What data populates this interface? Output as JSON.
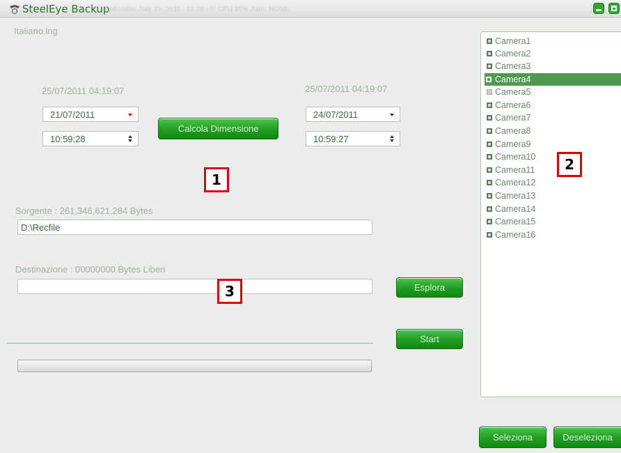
{
  "window": {
    "title": "SteelEye Backup",
    "ghost_text": "1    Monday,July 25, 2011 - 11:20  -  5' CPU 36%   Join: NONE"
  },
  "language_file": "Italiano.lng",
  "start": {
    "current_datetime": "25/07/2011 04:19:07",
    "date": "21/07/2011",
    "time": "10:59:28"
  },
  "end": {
    "current_datetime": "25/07/2011 04:19:07",
    "date": "24/07/2011",
    "time": "10:59:27"
  },
  "buttons": {
    "calcola": "Calcola Dimensione",
    "esplora": "Esplora",
    "start": "Start",
    "seleziona": "Seleziona",
    "deseleziona": "Deseleziona"
  },
  "source": {
    "label": "Sorgente : 261,346,621,284 Bytes",
    "path": "D:\\Recfile"
  },
  "destination": {
    "label": "Destinazione : 00000000 Bytes Liberi",
    "path": ""
  },
  "markers": [
    "1",
    "2",
    "3"
  ],
  "cameras": [
    {
      "label": "Camera1",
      "checked": true,
      "selected": false
    },
    {
      "label": "Camera2",
      "checked": true,
      "selected": false
    },
    {
      "label": "Camera3",
      "checked": true,
      "selected": false
    },
    {
      "label": "Camera4",
      "checked": true,
      "selected": true
    },
    {
      "label": "Camera5",
      "checked": false,
      "selected": false
    },
    {
      "label": "Camera6",
      "checked": true,
      "selected": false
    },
    {
      "label": "Camera7",
      "checked": true,
      "selected": false
    },
    {
      "label": "Camera8",
      "checked": true,
      "selected": false
    },
    {
      "label": "Camera9",
      "checked": true,
      "selected": false
    },
    {
      "label": "Camera10",
      "checked": true,
      "selected": false
    },
    {
      "label": "Camera11",
      "checked": true,
      "selected": false
    },
    {
      "label": "Camera12",
      "checked": true,
      "selected": false
    },
    {
      "label": "Camera13",
      "checked": true,
      "selected": false
    },
    {
      "label": "Camera14",
      "checked": true,
      "selected": false
    },
    {
      "label": "Camera15",
      "checked": true,
      "selected": false
    },
    {
      "label": "Camera16",
      "checked": true,
      "selected": false
    }
  ],
  "progress": 0,
  "colors": {
    "accent": "#23a023",
    "selection": "#4f9a4f",
    "marker_border": "#e00000"
  }
}
